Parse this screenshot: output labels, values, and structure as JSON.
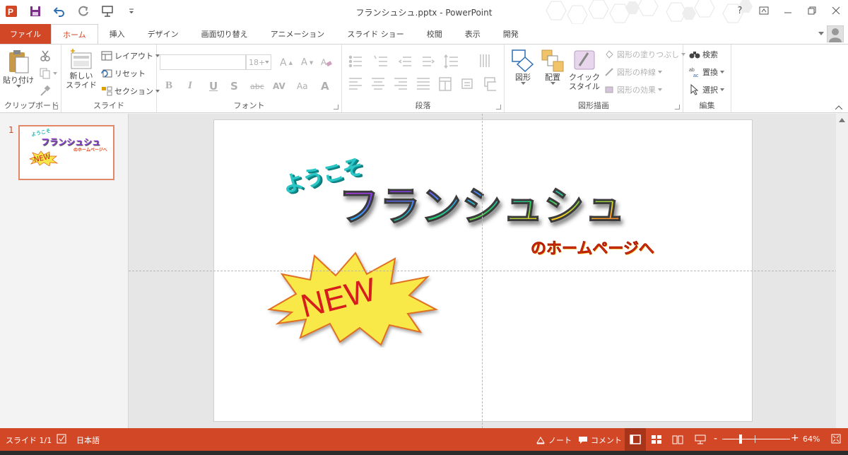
{
  "title_bar": {
    "doc_title": "フランシュシュ.pptx - PowerPoint",
    "help": "?"
  },
  "tabs": [
    {
      "label": "ファイル",
      "kind": "file"
    },
    {
      "label": "ホーム",
      "kind": "active"
    },
    {
      "label": "挿入"
    },
    {
      "label": "デザイン"
    },
    {
      "label": "画面切り替え"
    },
    {
      "label": "アニメーション"
    },
    {
      "label": "スライド ショー"
    },
    {
      "label": "校閲"
    },
    {
      "label": "表示"
    },
    {
      "label": "開発"
    }
  ],
  "ribbon": {
    "clipboard": {
      "paste": "貼り付け",
      "group": "クリップボード"
    },
    "slides": {
      "new_slide_1": "新しい",
      "new_slide_2": "スライド",
      "layout": "レイアウト",
      "reset": "リセット",
      "section": "セクション",
      "group": "スライド"
    },
    "font": {
      "size": "18+",
      "group": "フォント",
      "bold": "B",
      "italic": "I",
      "underline": "U",
      "shadow": "S",
      "strike": "abc",
      "spacing": "AV",
      "case": "Aa",
      "color": "A"
    },
    "paragraph": {
      "group": "段落"
    },
    "drawing": {
      "shapes": "図形",
      "arrange": "配置",
      "quick_style_1": "クイック",
      "quick_style_2": "スタイル",
      "fill": "図形の塗りつぶし",
      "outline": "図形の枠線",
      "effects": "図形の効果",
      "group": "図形描画"
    },
    "editing": {
      "find": "検索",
      "replace": "置換",
      "select": "選択",
      "group": "編集"
    }
  },
  "thumbnail": {
    "number": "1",
    "title": "フランシュシュ",
    "sub": "ようこそ",
    "tail": "のホームページへ",
    "badge": "NEW"
  },
  "slide": {
    "welcome": "ようこそ",
    "main_title": "フランシュシュ",
    "subtitle": "のホームページへ",
    "badge": "NEW"
  },
  "status": {
    "slide_count": "スライド 1/1",
    "language": "日本語",
    "notes": "ノート",
    "comments": "コメント",
    "zoom": "64%",
    "zoom_minus": "-",
    "zoom_plus": "+"
  },
  "colors": {
    "accent": "#d24726",
    "accent_dark": "#a83519"
  },
  "icons": [
    "powerpoint-logo-icon",
    "save-icon",
    "undo-icon",
    "redo-icon",
    "presentation-icon",
    "customize-icon"
  ]
}
